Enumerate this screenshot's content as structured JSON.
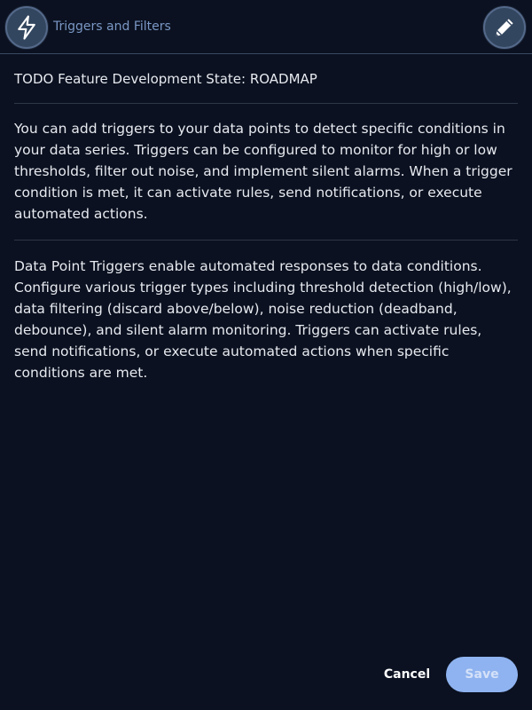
{
  "header": {
    "title": "Triggers and Filters",
    "left_icon": "lightning-bolt-icon",
    "right_icon": "pencil-icon"
  },
  "content": {
    "state_line": "TODO Feature Development State: ROADMAP",
    "paragraph_1": "You can add triggers to your data points to detect specific conditions in your data series. Triggers can be configured to monitor for high or low thresholds, filter out noise, and implement silent alarms. When a trigger condition is met, it can activate rules, send notifications, or execute automated actions.",
    "paragraph_2": "Data Point Triggers enable automated responses to data conditions. Configure various trigger types including threshold detection (high/low), data filtering (discard above/below), noise reduction (deadband, debounce), and silent alarm monitoring. Triggers can activate rules, send notifications, or execute automated actions when specific conditions are met."
  },
  "footer": {
    "cancel_label": "Cancel",
    "save_label": "Save"
  },
  "colors": {
    "background": "#0b1120",
    "accent": "#7a97c4",
    "save_button": "#8fb3f0"
  }
}
